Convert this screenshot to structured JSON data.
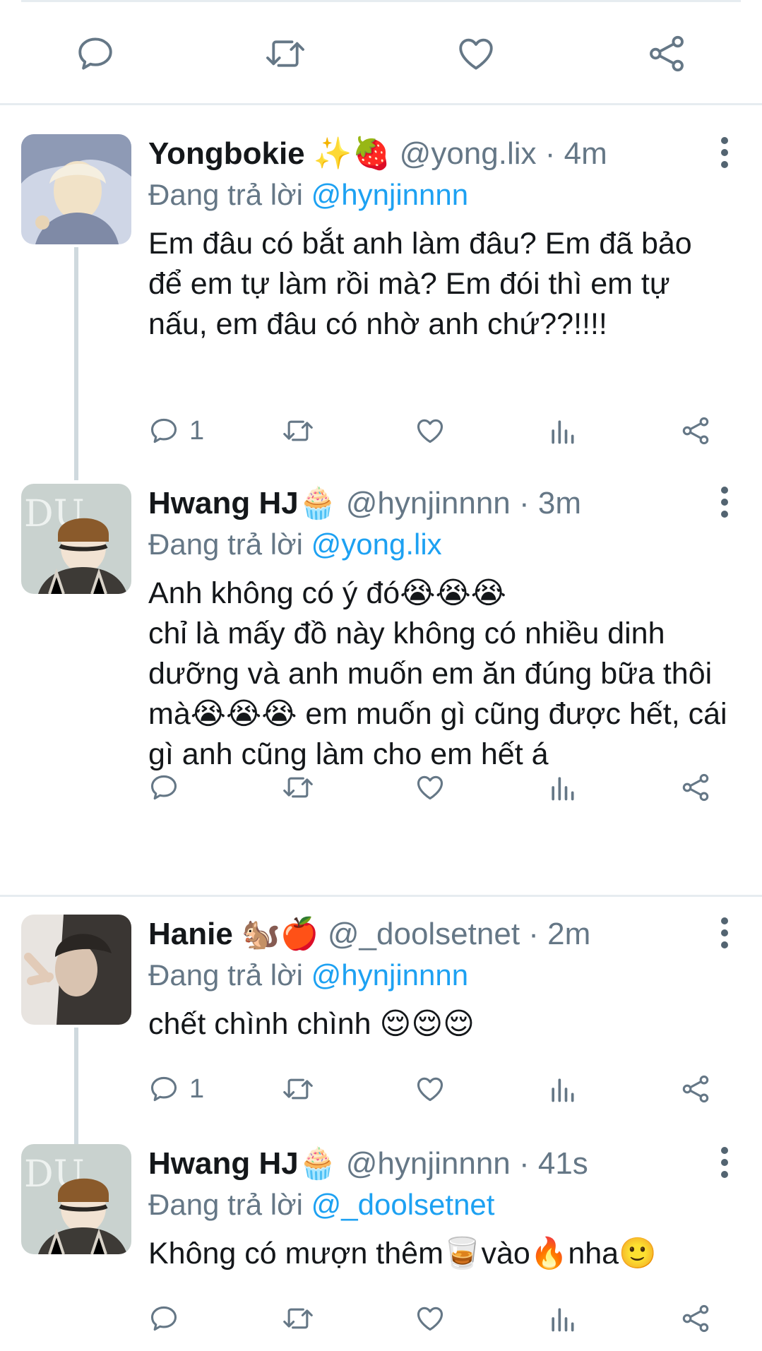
{
  "top_actions": {
    "icons": [
      "reply-icon",
      "retweet-icon",
      "like-icon",
      "share-icon"
    ]
  },
  "tweets": [
    {
      "name": "Yongbokie ✨🍓",
      "handle": "@yong.lix · 4m",
      "replying_prefix": "Đang trả lời ",
      "replying_to": "@hynjinnnn",
      "text": "Em đâu có bắt anh làm đâu? Em đã bảo để em tự làm rồi mà? Em đói thì em tự nấu, em đâu có nhờ anh chứ??!!!!",
      "reply_count": "1",
      "avatar_colors": [
        "#cfd6e6",
        "#f1e2c7",
        "#7f8aa6"
      ]
    },
    {
      "name": "Hwang HJ🧁",
      "handle": "@hynjinnnn · 3m",
      "replying_prefix": "Đang trả lời ",
      "replying_to": "@yong.lix",
      "text": "Anh không có ý đó😭😭😭\nchỉ là mấy đồ này không có nhiều dinh dưỡng và anh muốn em ăn đúng bữa thôi mà😭😭😭 em muốn gì cũng được hết, cái gì anh cũng làm cho em hết á",
      "reply_count": "",
      "avatar_colors": [
        "#c9d2cf",
        "#8a5a2b",
        "#3d3a36"
      ]
    },
    {
      "name": "Hanie 🐿️🍎",
      "handle": "@_doolsetnet · 2m",
      "replying_prefix": "Đang trả lời ",
      "replying_to": "@hynjinnnn",
      "text": "chết chình chình 😌😌😌",
      "reply_count": "1",
      "avatar_colors": [
        "#e8e4e0",
        "#3a3633",
        "#d9c3b0"
      ]
    },
    {
      "name": "Hwang HJ🧁",
      "handle": "@hynjinnnn · 41s",
      "replying_prefix": "Đang trả lời ",
      "replying_to": "@_doolsetnet",
      "text": "Không có mượn thêm🥃vào🔥nha🙂",
      "reply_count": "",
      "avatar_colors": [
        "#c9d2cf",
        "#8a5a2b",
        "#3d3a36"
      ]
    }
  ],
  "colors": {
    "mention": "#1da1f2",
    "muted": "#657786",
    "divider": "#e6ecf0",
    "thread_line": "#cfd9de"
  }
}
